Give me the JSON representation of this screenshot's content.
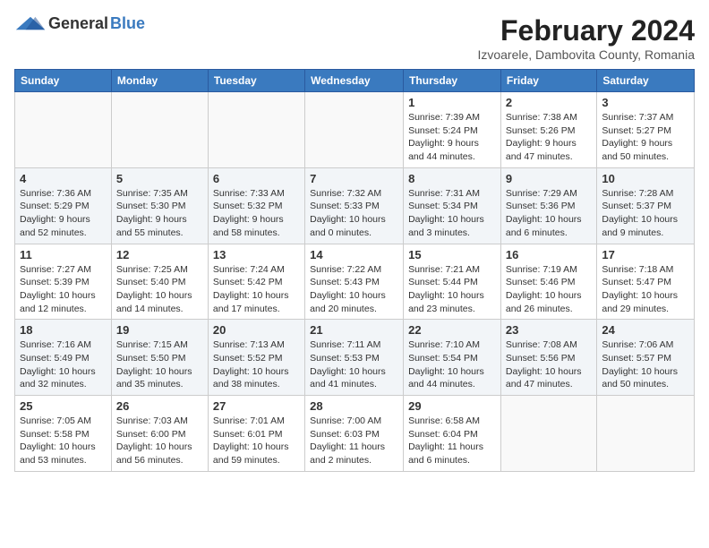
{
  "header": {
    "logo_general": "General",
    "logo_blue": "Blue",
    "month_title": "February 2024",
    "location": "Izvoarele, Dambovita County, Romania"
  },
  "weekdays": [
    "Sunday",
    "Monday",
    "Tuesday",
    "Wednesday",
    "Thursday",
    "Friday",
    "Saturday"
  ],
  "rows": [
    [
      {
        "day": "",
        "content": ""
      },
      {
        "day": "",
        "content": ""
      },
      {
        "day": "",
        "content": ""
      },
      {
        "day": "",
        "content": ""
      },
      {
        "day": "1",
        "content": "Sunrise: 7:39 AM\nSunset: 5:24 PM\nDaylight: 9 hours\nand 44 minutes."
      },
      {
        "day": "2",
        "content": "Sunrise: 7:38 AM\nSunset: 5:26 PM\nDaylight: 9 hours\nand 47 minutes."
      },
      {
        "day": "3",
        "content": "Sunrise: 7:37 AM\nSunset: 5:27 PM\nDaylight: 9 hours\nand 50 minutes."
      }
    ],
    [
      {
        "day": "4",
        "content": "Sunrise: 7:36 AM\nSunset: 5:29 PM\nDaylight: 9 hours\nand 52 minutes."
      },
      {
        "day": "5",
        "content": "Sunrise: 7:35 AM\nSunset: 5:30 PM\nDaylight: 9 hours\nand 55 minutes."
      },
      {
        "day": "6",
        "content": "Sunrise: 7:33 AM\nSunset: 5:32 PM\nDaylight: 9 hours\nand 58 minutes."
      },
      {
        "day": "7",
        "content": "Sunrise: 7:32 AM\nSunset: 5:33 PM\nDaylight: 10 hours\nand 0 minutes."
      },
      {
        "day": "8",
        "content": "Sunrise: 7:31 AM\nSunset: 5:34 PM\nDaylight: 10 hours\nand 3 minutes."
      },
      {
        "day": "9",
        "content": "Sunrise: 7:29 AM\nSunset: 5:36 PM\nDaylight: 10 hours\nand 6 minutes."
      },
      {
        "day": "10",
        "content": "Sunrise: 7:28 AM\nSunset: 5:37 PM\nDaylight: 10 hours\nand 9 minutes."
      }
    ],
    [
      {
        "day": "11",
        "content": "Sunrise: 7:27 AM\nSunset: 5:39 PM\nDaylight: 10 hours\nand 12 minutes."
      },
      {
        "day": "12",
        "content": "Sunrise: 7:25 AM\nSunset: 5:40 PM\nDaylight: 10 hours\nand 14 minutes."
      },
      {
        "day": "13",
        "content": "Sunrise: 7:24 AM\nSunset: 5:42 PM\nDaylight: 10 hours\nand 17 minutes."
      },
      {
        "day": "14",
        "content": "Sunrise: 7:22 AM\nSunset: 5:43 PM\nDaylight: 10 hours\nand 20 minutes."
      },
      {
        "day": "15",
        "content": "Sunrise: 7:21 AM\nSunset: 5:44 PM\nDaylight: 10 hours\nand 23 minutes."
      },
      {
        "day": "16",
        "content": "Sunrise: 7:19 AM\nSunset: 5:46 PM\nDaylight: 10 hours\nand 26 minutes."
      },
      {
        "day": "17",
        "content": "Sunrise: 7:18 AM\nSunset: 5:47 PM\nDaylight: 10 hours\nand 29 minutes."
      }
    ],
    [
      {
        "day": "18",
        "content": "Sunrise: 7:16 AM\nSunset: 5:49 PM\nDaylight: 10 hours\nand 32 minutes."
      },
      {
        "day": "19",
        "content": "Sunrise: 7:15 AM\nSunset: 5:50 PM\nDaylight: 10 hours\nand 35 minutes."
      },
      {
        "day": "20",
        "content": "Sunrise: 7:13 AM\nSunset: 5:52 PM\nDaylight: 10 hours\nand 38 minutes."
      },
      {
        "day": "21",
        "content": "Sunrise: 7:11 AM\nSunset: 5:53 PM\nDaylight: 10 hours\nand 41 minutes."
      },
      {
        "day": "22",
        "content": "Sunrise: 7:10 AM\nSunset: 5:54 PM\nDaylight: 10 hours\nand 44 minutes."
      },
      {
        "day": "23",
        "content": "Sunrise: 7:08 AM\nSunset: 5:56 PM\nDaylight: 10 hours\nand 47 minutes."
      },
      {
        "day": "24",
        "content": "Sunrise: 7:06 AM\nSunset: 5:57 PM\nDaylight: 10 hours\nand 50 minutes."
      }
    ],
    [
      {
        "day": "25",
        "content": "Sunrise: 7:05 AM\nSunset: 5:58 PM\nDaylight: 10 hours\nand 53 minutes."
      },
      {
        "day": "26",
        "content": "Sunrise: 7:03 AM\nSunset: 6:00 PM\nDaylight: 10 hours\nand 56 minutes."
      },
      {
        "day": "27",
        "content": "Sunrise: 7:01 AM\nSunset: 6:01 PM\nDaylight: 10 hours\nand 59 minutes."
      },
      {
        "day": "28",
        "content": "Sunrise: 7:00 AM\nSunset: 6:03 PM\nDaylight: 11 hours\nand 2 minutes."
      },
      {
        "day": "29",
        "content": "Sunrise: 6:58 AM\nSunset: 6:04 PM\nDaylight: 11 hours\nand 6 minutes."
      },
      {
        "day": "",
        "content": ""
      },
      {
        "day": "",
        "content": ""
      }
    ]
  ]
}
